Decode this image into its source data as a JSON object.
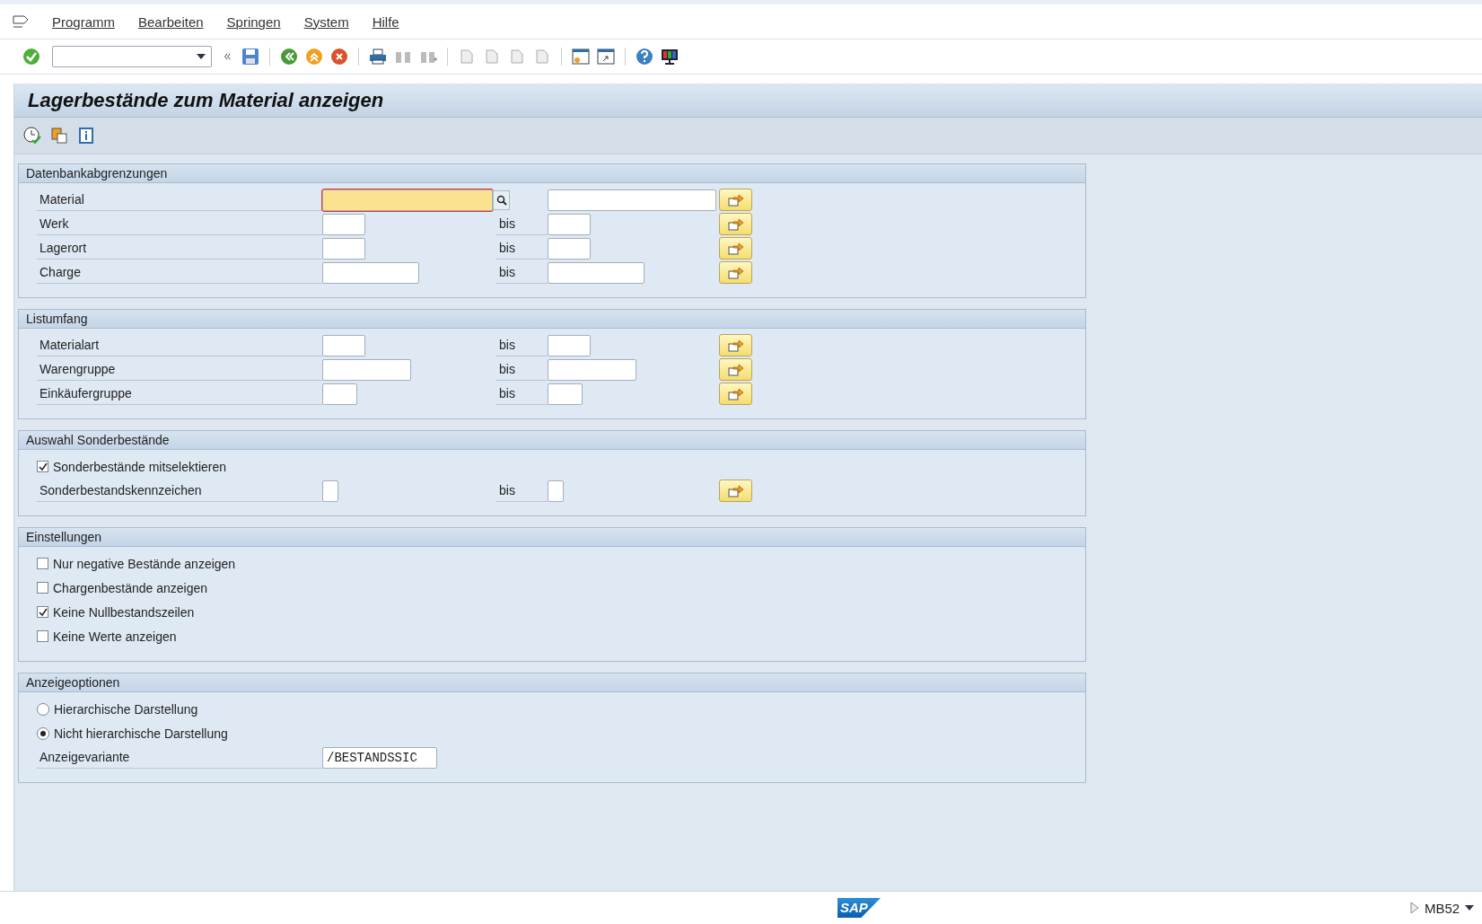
{
  "menu": [
    {
      "label": "Programm"
    },
    {
      "label": "Bearbeiten"
    },
    {
      "label": "Springen"
    },
    {
      "label": "System"
    },
    {
      "label": "Hilfe"
    }
  ],
  "title": "Lagerbestände zum Material anzeigen",
  "sections": [
    {
      "title": "Datenbankabgrenzungen",
      "rows": [
        {
          "kind": "range",
          "label": "Material",
          "focused": true,
          "search_help": true
        },
        {
          "kind": "range",
          "label": "Werk",
          "to_label": "bis",
          "focused": false,
          "search_help": false
        },
        {
          "kind": "range",
          "label": "Lagerort",
          "to_label": "bis",
          "focused": false,
          "search_help": false
        },
        {
          "kind": "range",
          "label": "Charge",
          "to_label": "bis",
          "focused": false,
          "search_help": false
        }
      ]
    },
    {
      "title": "Listumfang",
      "rows": [
        {
          "kind": "range",
          "label": "Materialart",
          "to_label": "bis",
          "focused": false,
          "search_help": false
        },
        {
          "kind": "range",
          "label": "Warengruppe",
          "to_label": "bis",
          "focused": false,
          "search_help": false
        },
        {
          "kind": "range",
          "label": "Einkäufergruppe",
          "to_label": "bis",
          "focused": false,
          "search_help": false
        }
      ]
    },
    {
      "title": "Auswahl Sonderbestände",
      "rows": [
        {
          "kind": "checkbox",
          "label": "Sonderbestände mitselektieren",
          "checked": true
        },
        {
          "kind": "range",
          "label": "Sonderbestandskennzeichen",
          "to_label": "bis",
          "focused": false,
          "search_help": false
        }
      ]
    },
    {
      "title": "Einstellungen",
      "rows": [
        {
          "kind": "checkbox",
          "label": "Nur negative Bestände anzeigen",
          "checked": false
        },
        {
          "kind": "checkbox",
          "label": "Chargenbestände anzeigen",
          "checked": false
        },
        {
          "kind": "checkbox",
          "label": "Keine Nullbestandszeilen",
          "checked": true
        },
        {
          "kind": "checkbox",
          "label": "Keine Werte anzeigen",
          "checked": false
        }
      ]
    },
    {
      "title": "Anzeigeoptionen",
      "rows": [
        {
          "kind": "radio",
          "label": "Hierarchische Darstellung",
          "selected": false
        },
        {
          "kind": "radio",
          "label": "Nicht hierarchische Darstellung",
          "selected": true
        },
        {
          "kind": "field",
          "label": "Anzeigevariante",
          "value": "/BESTANDSSIC"
        }
      ]
    }
  ],
  "status_bar": {
    "logo": "SAP",
    "transaction": "MB52"
  }
}
